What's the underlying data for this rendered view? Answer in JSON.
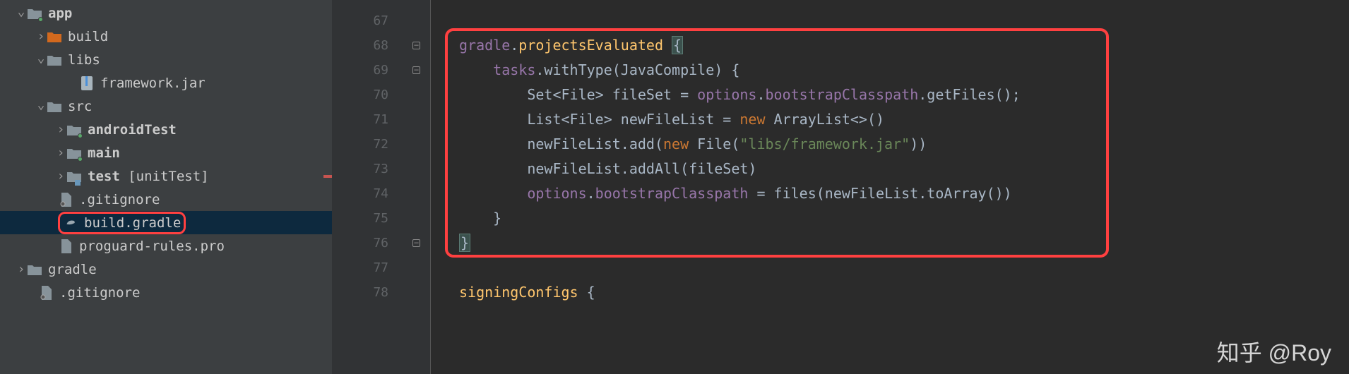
{
  "tree": {
    "app": "app",
    "build": "build",
    "libs": "libs",
    "framework_jar": "framework.jar",
    "src": "src",
    "androidTest": "androidTest",
    "main": "main",
    "test_prefix": "test ",
    "test_suffix": "[unitTest]",
    "gitignore": ".gitignore",
    "build_gradle": "build.gradle",
    "proguard": "proguard-rules.pro",
    "gradle": "gradle",
    "gitignore2": ".gitignore"
  },
  "gutter": [
    "67",
    "68",
    "69",
    "70",
    "71",
    "72",
    "73",
    "74",
    "75",
    "76",
    "77",
    "78"
  ],
  "code": {
    "l68a": "gradle",
    "l68b": ".",
    "l68c": "projectsEvaluated ",
    "l68d": "{",
    "l69a": "    tasks",
    "l69b": ".withType(JavaCompile) {",
    "l70a": "        Set<File> fileSet = ",
    "l70b": "options",
    "l70c": ".",
    "l70d": "bootstrapClasspath",
    "l70e": ".getFiles();",
    "l71a": "        List<File> newFileList = ",
    "l71b": "new",
    "l71c": " ArrayList<>()",
    "l72a": "        newFileList.add(",
    "l72b": "new",
    "l72c": " File(",
    "l72d": "\"libs/framework.jar\"",
    "l72e": "))",
    "l73a": "        newFileList.addAll(fileSet)",
    "l74a": "        ",
    "l74b": "options",
    "l74c": ".",
    "l74d": "bootstrapClasspath",
    "l74e": " = files(newFileList.toArray())",
    "l75a": "    }",
    "l76a": "}",
    "l78a": "signingConfigs ",
    "l78b": "{"
  },
  "watermark": "知乎 @Roy"
}
